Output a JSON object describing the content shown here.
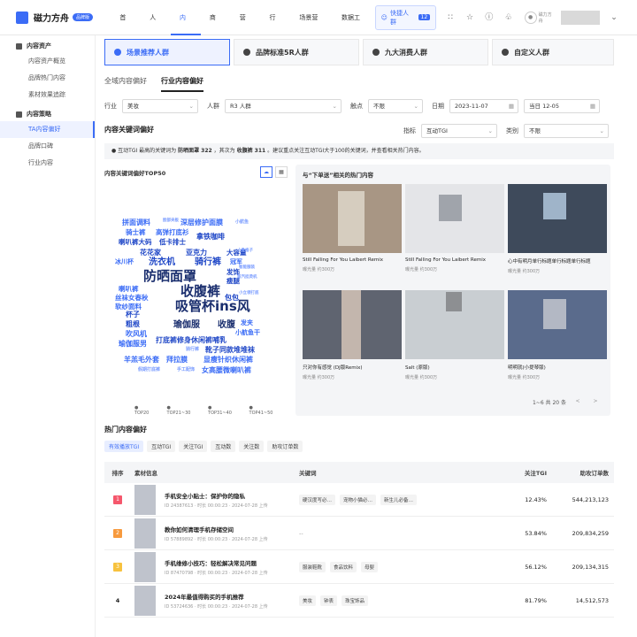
{
  "app": {
    "title": "磁力方舟",
    "badge": "品牌版"
  },
  "nav": [
    "首页",
    "人群",
    "内容",
    "商品",
    "营销",
    "行业",
    "场景营销",
    "数据工厂"
  ],
  "nav_active": 2,
  "topright": {
    "quick_label": "快捷人群",
    "quick_count": "12",
    "avatar_label": "磁力方舟"
  },
  "sidebar": {
    "group1": "内容资产",
    "group1_items": [
      "内容资产概览",
      "品牌热门内容",
      "素材效果追踪"
    ],
    "group2": "内容策略",
    "group2_items": [
      "TA内容偏好",
      "品牌口碑",
      "行业内容"
    ]
  },
  "categories": [
    "场景推荐人群",
    "品牌标准5R人群",
    "九大消费人群",
    "自定义人群"
  ],
  "subtabs": [
    "全域内容偏好",
    "行业内容偏好"
  ],
  "filters": {
    "industry_label": "行业",
    "industry_value": "美妆",
    "crowd_label": "人群",
    "crowd_value": "R3 人群",
    "touch_label": "触点",
    "touch_value": "不限",
    "date_label": "日期",
    "date_start": "2023-11-07",
    "date_end": "当日 12-05"
  },
  "section1": {
    "title": "内容关键词偏好",
    "metric_label": "指标",
    "metric_value": "互动TGI",
    "type_label": "类别",
    "type_value": "不限"
  },
  "notice": {
    "prefix": "互动TGI 最高的关键词为",
    "kw1": "防晒面罩 322",
    "mid": "，其次为",
    "kw2": "收腹裤 311",
    "suffix": "。建议重点关注互动TGI大于100的关键词，并查看相关热门内容。"
  },
  "wordcloud": {
    "title": "内容关键词偏好TOP50",
    "words": [
      "拼面调料",
      "脸部夹板",
      "深层修护面膜",
      "小航鱼",
      "骑士裤",
      "高弹打底衫",
      "拿铁咖啡",
      "喇叭裤大码",
      "低卡排士",
      "花花家",
      "亚克力",
      "大容量",
      "小骨格子",
      "冰川杯",
      "洗衣机",
      "骑行裤",
      "冠军",
      "防晒面罩",
      "发饰",
      "智能服装",
      "瘦腿",
      "蒸汽挂烫机",
      "收腹裤",
      "喇叭裤",
      "丝袜女春秋",
      "包包",
      "小立领打底",
      "软纱面料",
      "吸管杯ins风",
      "杯子",
      "粗根",
      "瑜伽服",
      "收腹",
      "发夹",
      "吹风机",
      "小航鱼干",
      "瑜伽服男",
      "打底裤修身休闲裤哺乳",
      "骑行裤",
      "靴子同款堆堆袜",
      "羊羔毛外套",
      "拜拉膜",
      "显瘦针织休闲裤",
      "假期打底裤",
      "手工配饰",
      "女高腰微喇叭裤"
    ],
    "legend": [
      "TOP20",
      "TOP21~30",
      "TOP31~40",
      "TOP41~50"
    ]
  },
  "hot": {
    "title": "与“下单送”相关的热门内容",
    "cards": [
      {
        "title": "Still Falling For You Laibert Remix",
        "meta": "曝光量 约300万"
      },
      {
        "title": "Still Falling For You Laibert Remix",
        "meta": "曝光量 约300万"
      },
      {
        "title": "心中有明月单行标题单行标题单行标题",
        "meta": "曝光量 约300万"
      },
      {
        "title": "只对你有感觉 (DJ版Remix)",
        "meta": "曝光量 约300万"
      },
      {
        "title": "Salt (原版)",
        "meta": "曝光量 约300万"
      },
      {
        "title": "明明就(小提琴版)",
        "meta": "曝光量 约300万"
      }
    ],
    "pager": "1~6 共 20 条"
  },
  "section2": {
    "title": "热门内容偏好",
    "pills": [
      "有效播放TGI",
      "互动TGI",
      "关注TGI",
      "互动数",
      "关注数",
      "助攻订单数"
    ]
  },
  "table": {
    "headers": [
      "排序",
      "素材信息",
      "关键词",
      "关注TGI",
      "助攻订单数"
    ],
    "rows": [
      {
        "rank": "1",
        "title": "手机安全小贴士：保护你的隐私",
        "meta": "ID 24387613 · 时长 00:00:23 · 2024-07-28 上传",
        "tags": [
          "硬汉度写必…",
          "宠物小猫必…",
          "新生儿必备…"
        ],
        "tgi": "12.43%",
        "orders": "544,213,123"
      },
      {
        "rank": "2",
        "title": "教你如何清理手机存储空间",
        "meta": "ID 57889892 · 时长 00:00:23 · 2024-07-28 上传",
        "tags": [
          "--"
        ],
        "tgi": "53.84%",
        "orders": "209,834,259"
      },
      {
        "rank": "3",
        "title": "手机维修小技巧：轻松解决常见问题",
        "meta": "ID 87470798 · 时长 00:00:23 · 2024-07-28 上传",
        "tags": [
          "服装鞋靴",
          "食品饮料",
          "母婴"
        ],
        "tgi": "56.12%",
        "orders": "209,134,315"
      },
      {
        "rank": "4",
        "title": "2024年最值得购买的手机推荐",
        "meta": "ID 53724636 · 时长 00:00:23 · 2024-07-28 上传",
        "tags": [
          "美妆",
          "钟表",
          "珠宝饰品"
        ],
        "tgi": "81.79%",
        "orders": "14,512,573"
      }
    ]
  },
  "colors": {
    "accent": "#3b6cf6",
    "rank1": "#f5576c",
    "rank2": "#f79a3e",
    "rank3": "#f7c23e"
  }
}
